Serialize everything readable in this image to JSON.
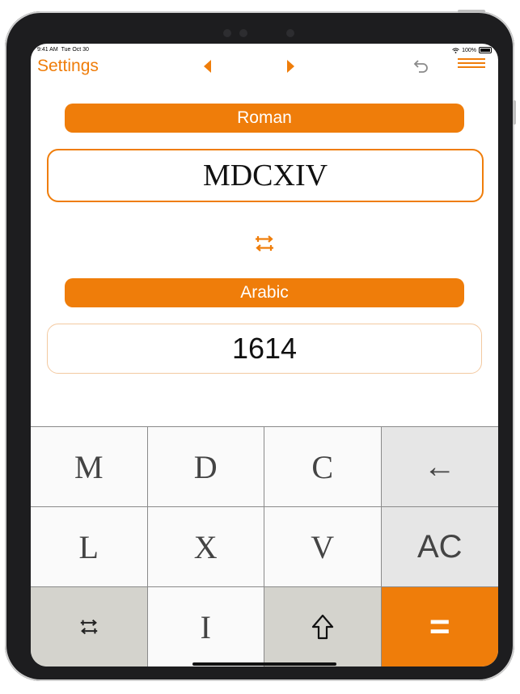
{
  "status_bar": {
    "time": "9:41 AM",
    "date": "Tue Oct 30",
    "battery": "100%"
  },
  "nav": {
    "settings_label": "Settings",
    "prev_icon": "triangle-left-icon",
    "next_icon": "triangle-right-icon",
    "undo_icon": "undo-icon",
    "menu_icon": "hamburger-menu-icon"
  },
  "roman": {
    "label": "Roman",
    "value": "MDCXIV"
  },
  "arabic": {
    "label": "Arabic",
    "value": "1614"
  },
  "swap_icon": "swap-arrows-icon",
  "keys": [
    {
      "label": "M",
      "name": "key-m"
    },
    {
      "label": "D",
      "name": "key-d"
    },
    {
      "label": "C",
      "name": "key-c"
    },
    {
      "label": "←",
      "name": "key-backspace"
    },
    {
      "label": "L",
      "name": "key-l"
    },
    {
      "label": "X",
      "name": "key-x"
    },
    {
      "label": "V",
      "name": "key-v"
    },
    {
      "label": "AC",
      "name": "key-all-clear"
    },
    {
      "label": "",
      "name": "key-swap",
      "icon": "swap-arrows-icon"
    },
    {
      "label": "I",
      "name": "key-i"
    },
    {
      "label": "",
      "name": "key-shift",
      "icon": "shift-arrow-icon"
    },
    {
      "label": "=",
      "name": "key-equals"
    }
  ],
  "colors": {
    "accent": "#ef7d0a",
    "key_light": "#fafafa",
    "key_gray": "#e6e6e6",
    "key_dark": "#d4d3cd"
  }
}
